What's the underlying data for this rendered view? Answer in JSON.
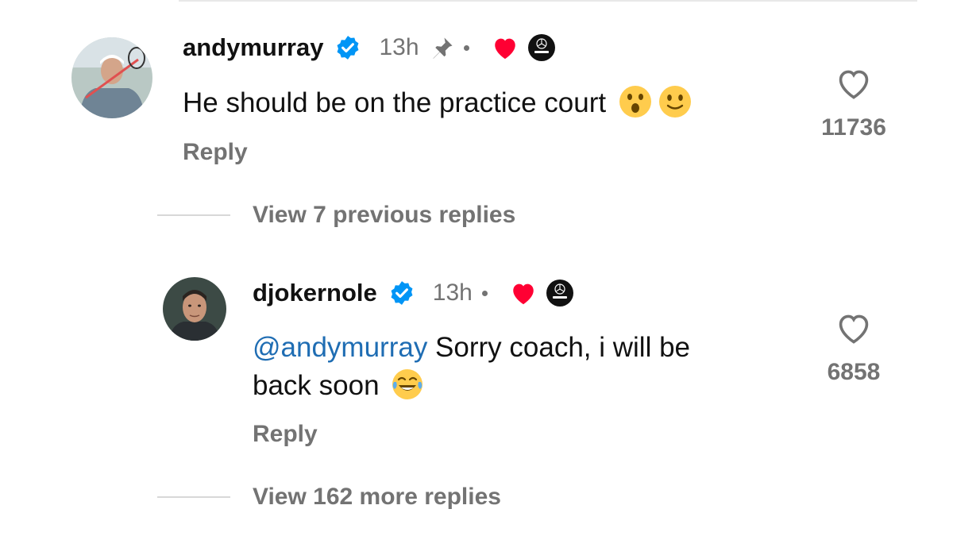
{
  "comments": [
    {
      "username": "andymurray",
      "time": "13h",
      "text": "He should be on the practice court",
      "reply_label": "Reply",
      "like_count": "11736",
      "pinned": true
    },
    {
      "username": "djokernole",
      "time": "13h",
      "mention": "@andymurray",
      "text_line1": " Sorry coach, i will be",
      "text_line2": "back soon",
      "reply_label": "Reply",
      "like_count": "6858"
    }
  ],
  "view_previous": "View 7 previous replies",
  "view_more": "View 162 more replies",
  "colors": {
    "verified": "#0095f6",
    "liked_heart": "#ff0033",
    "secondary_text": "#737373",
    "mention": "#1f6db3"
  },
  "icons": [
    "verified-badge-icon",
    "pin-icon",
    "red-heart-icon",
    "mercedes-amg-badge-icon",
    "heart-outline-icon",
    "astonished-face-emoji",
    "slightly-smiling-face-emoji",
    "tears-of-joy-emoji"
  ]
}
